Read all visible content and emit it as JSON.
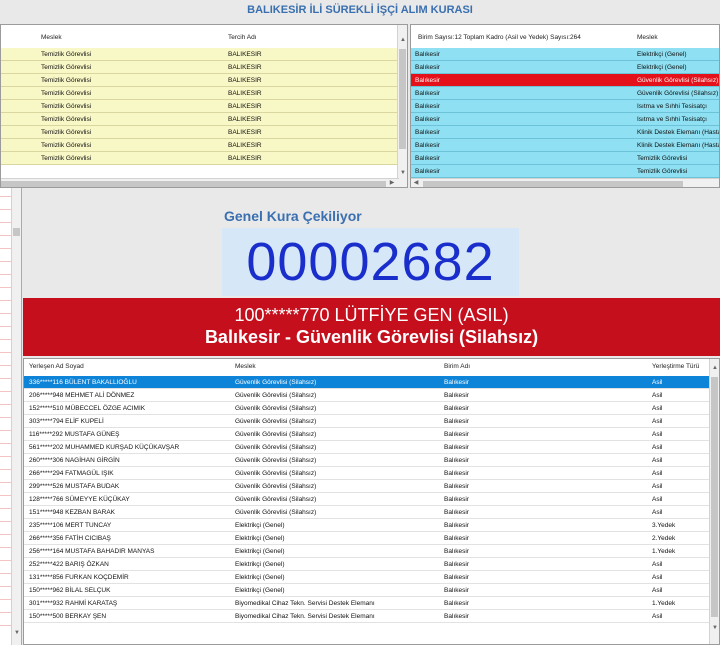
{
  "app": {
    "title": "BALIKESİR İLİ SÜREKLİ İŞÇİ ALIM KURASI"
  },
  "top_left_table": {
    "headers": {
      "meslek": "Meslek",
      "tercih": "Tercih Adı"
    },
    "rows": [
      {
        "meslek": "Temizlik Görevlisi",
        "tercih": "BALIKESIR"
      },
      {
        "meslek": "Temizlik Görevlisi",
        "tercih": "BALIKESIR"
      },
      {
        "meslek": "Temizlik Görevlisi",
        "tercih": "BALIKESIR"
      },
      {
        "meslek": "Temizlik Görevlisi",
        "tercih": "BALIKESIR"
      },
      {
        "meslek": "Temizlik Görevlisi",
        "tercih": "BALIKESIR"
      },
      {
        "meslek": "Temizlik Görevlisi",
        "tercih": "BALIKESIR"
      },
      {
        "meslek": "Temizlik Görevlisi",
        "tercih": "BALIKESIR"
      },
      {
        "meslek": "Temizlik Görevlisi",
        "tercih": "BALIKESIR"
      },
      {
        "meslek": "Temizlik Görevlisi",
        "tercih": "BALIKESIR"
      }
    ]
  },
  "top_right_table": {
    "headers": {
      "birim": "Birim Sayısı:12 Toplam Kadro (Asil ve Yedek) Sayısı:264",
      "meslek": "Meslek"
    },
    "rows": [
      {
        "birim": "Balıkesir",
        "meslek": "Elektrikçi (Genel)"
      },
      {
        "birim": "Balıkesir",
        "meslek": "Elektrikçi (Genel)"
      },
      {
        "birim": "Balıkesir",
        "meslek": "Güvenlik Görevlisi (Silahsız)"
      },
      {
        "birim": "Balıkesir",
        "meslek": "Güvenlik Görevlisi (Silahsız)"
      },
      {
        "birim": "Balıkesir",
        "meslek": "Isıtma ve Sıhhi Tesisatçı"
      },
      {
        "birim": "Balıkesir",
        "meslek": "Isıtma ve Sıhhi Tesisatçı"
      },
      {
        "birim": "Balıkesir",
        "meslek": "Klinik Destek Elemanı (Hastane)"
      },
      {
        "birim": "Balıkesir",
        "meslek": "Klinik Destek Elemanı (Hastane)"
      },
      {
        "birim": "Balıkesir",
        "meslek": "Temizlik Görevlisi"
      },
      {
        "birim": "Balıkesir",
        "meslek": "Temizlik Görevlisi"
      }
    ]
  },
  "kura": {
    "label": "Genel Kura Çekiliyor",
    "number": "00002682"
  },
  "winner": {
    "line1": "100*****770 LÜTFİYE GEN (ASIL)",
    "line2": "Balıkesir - Güvenlik Görevlisi (Silahsız)"
  },
  "results_table": {
    "headers": {
      "name": "Yerleşen Ad Soyad",
      "meslek": "Meslek",
      "birim": "Birim Adı",
      "tur": "Yerleştirme Türü"
    },
    "rows": [
      {
        "name": "336*****116 BÜLENT BAKALLIOĞLU",
        "meslek": "Güvenlik Görevlisi (Silahsız)",
        "birim": "Balıkesir",
        "tur": "Asil"
      },
      {
        "name": "206*****948 MEHMET ALİ DÖNMEZ",
        "meslek": "Güvenlik Görevlisi (Silahsız)",
        "birim": "Balıkesir",
        "tur": "Asil"
      },
      {
        "name": "152*****510 MÜBECCEL ÖZGE ACIMIK",
        "meslek": "Güvenlik Görevlisi (Silahsız)",
        "birim": "Balıkesir",
        "tur": "Asil"
      },
      {
        "name": "303*****794 ELİF KUPELİ",
        "meslek": "Güvenlik Görevlisi (Silahsız)",
        "birim": "Balıkesir",
        "tur": "Asil"
      },
      {
        "name": "116*****292 MUSTAFA GÜNEŞ",
        "meslek": "Güvenlik Görevlisi (Silahsız)",
        "birim": "Balıkesir",
        "tur": "Asil"
      },
      {
        "name": "561*****202 MUHAMMED KURŞAD KÜÇÜKAVŞAR",
        "meslek": "Güvenlik Görevlisi (Silahsız)",
        "birim": "Balıkesir",
        "tur": "Asil"
      },
      {
        "name": "260*****306 NAGİHAN GİRGİN",
        "meslek": "Güvenlik Görevlisi (Silahsız)",
        "birim": "Balıkesir",
        "tur": "Asil"
      },
      {
        "name": "266*****294 FATMAGÜL IŞIK",
        "meslek": "Güvenlik Görevlisi (Silahsız)",
        "birim": "Balıkesir",
        "tur": "Asil"
      },
      {
        "name": "299*****526 MUSTAFA BUDAK",
        "meslek": "Güvenlik Görevlisi (Silahsız)",
        "birim": "Balıkesir",
        "tur": "Asil"
      },
      {
        "name": "128*****766 SÜMEYYE KÜÇÜKAY",
        "meslek": "Güvenlik Görevlisi (Silahsız)",
        "birim": "Balıkesir",
        "tur": "Asil"
      },
      {
        "name": "151*****948 KEZBAN BARAK",
        "meslek": "Güvenlik Görevlisi (Silahsız)",
        "birim": "Balıkesir",
        "tur": "Asil"
      },
      {
        "name": "235*****106 MERT TUNCAY",
        "meslek": "Elektrikçi (Genel)",
        "birim": "Balıkesir",
        "tur": "3.Yedek"
      },
      {
        "name": "266*****356 FATİH CICIBAŞ",
        "meslek": "Elektrikçi (Genel)",
        "birim": "Balıkesir",
        "tur": "2.Yedek"
      },
      {
        "name": "256*****164 MUSTAFA BAHADIR MANYAS",
        "meslek": "Elektrikçi (Genel)",
        "birim": "Balıkesir",
        "tur": "1.Yedek"
      },
      {
        "name": "252*****422 BARIŞ ÖZKAN",
        "meslek": "Elektrikçi (Genel)",
        "birim": "Balıkesir",
        "tur": "Asil"
      },
      {
        "name": "131*****856 FURKAN KOÇDEMİR",
        "meslek": "Elektrikçi (Genel)",
        "birim": "Balıkesir",
        "tur": "Asil"
      },
      {
        "name": "150*****962 BİLAL SELÇUK",
        "meslek": "Elektrikçi (Genel)",
        "birim": "Balıkesir",
        "tur": "Asil"
      },
      {
        "name": "301*****932 RAHMİ KARATAŞ",
        "meslek": "Biyomedikal Cihaz Tekn. Servisi Destek Elemanı",
        "birim": "Balıkesir",
        "tur": "1.Yedek"
      },
      {
        "name": "150*****500 BERKAY ŞEN",
        "meslek": "Biyomedikal Cihaz Tekn. Servisi Destek Elemanı",
        "birim": "Balıkesir",
        "tur": "Asil"
      }
    ]
  },
  "colors": {
    "top_left_row": "#f8f7c6",
    "top_right_row": "#8fe0f2",
    "top_right_selected": "#e4101a",
    "result_selected": "#0e84d8",
    "winner_banner": "#c50f1c",
    "kura_number": "#1a2ecc"
  },
  "icons": {
    "up": "scroll-up-arrow-icon",
    "down": "scroll-down-arrow-icon",
    "left": "scroll-left-arrow-icon",
    "right": "scroll-right-arrow-icon"
  }
}
